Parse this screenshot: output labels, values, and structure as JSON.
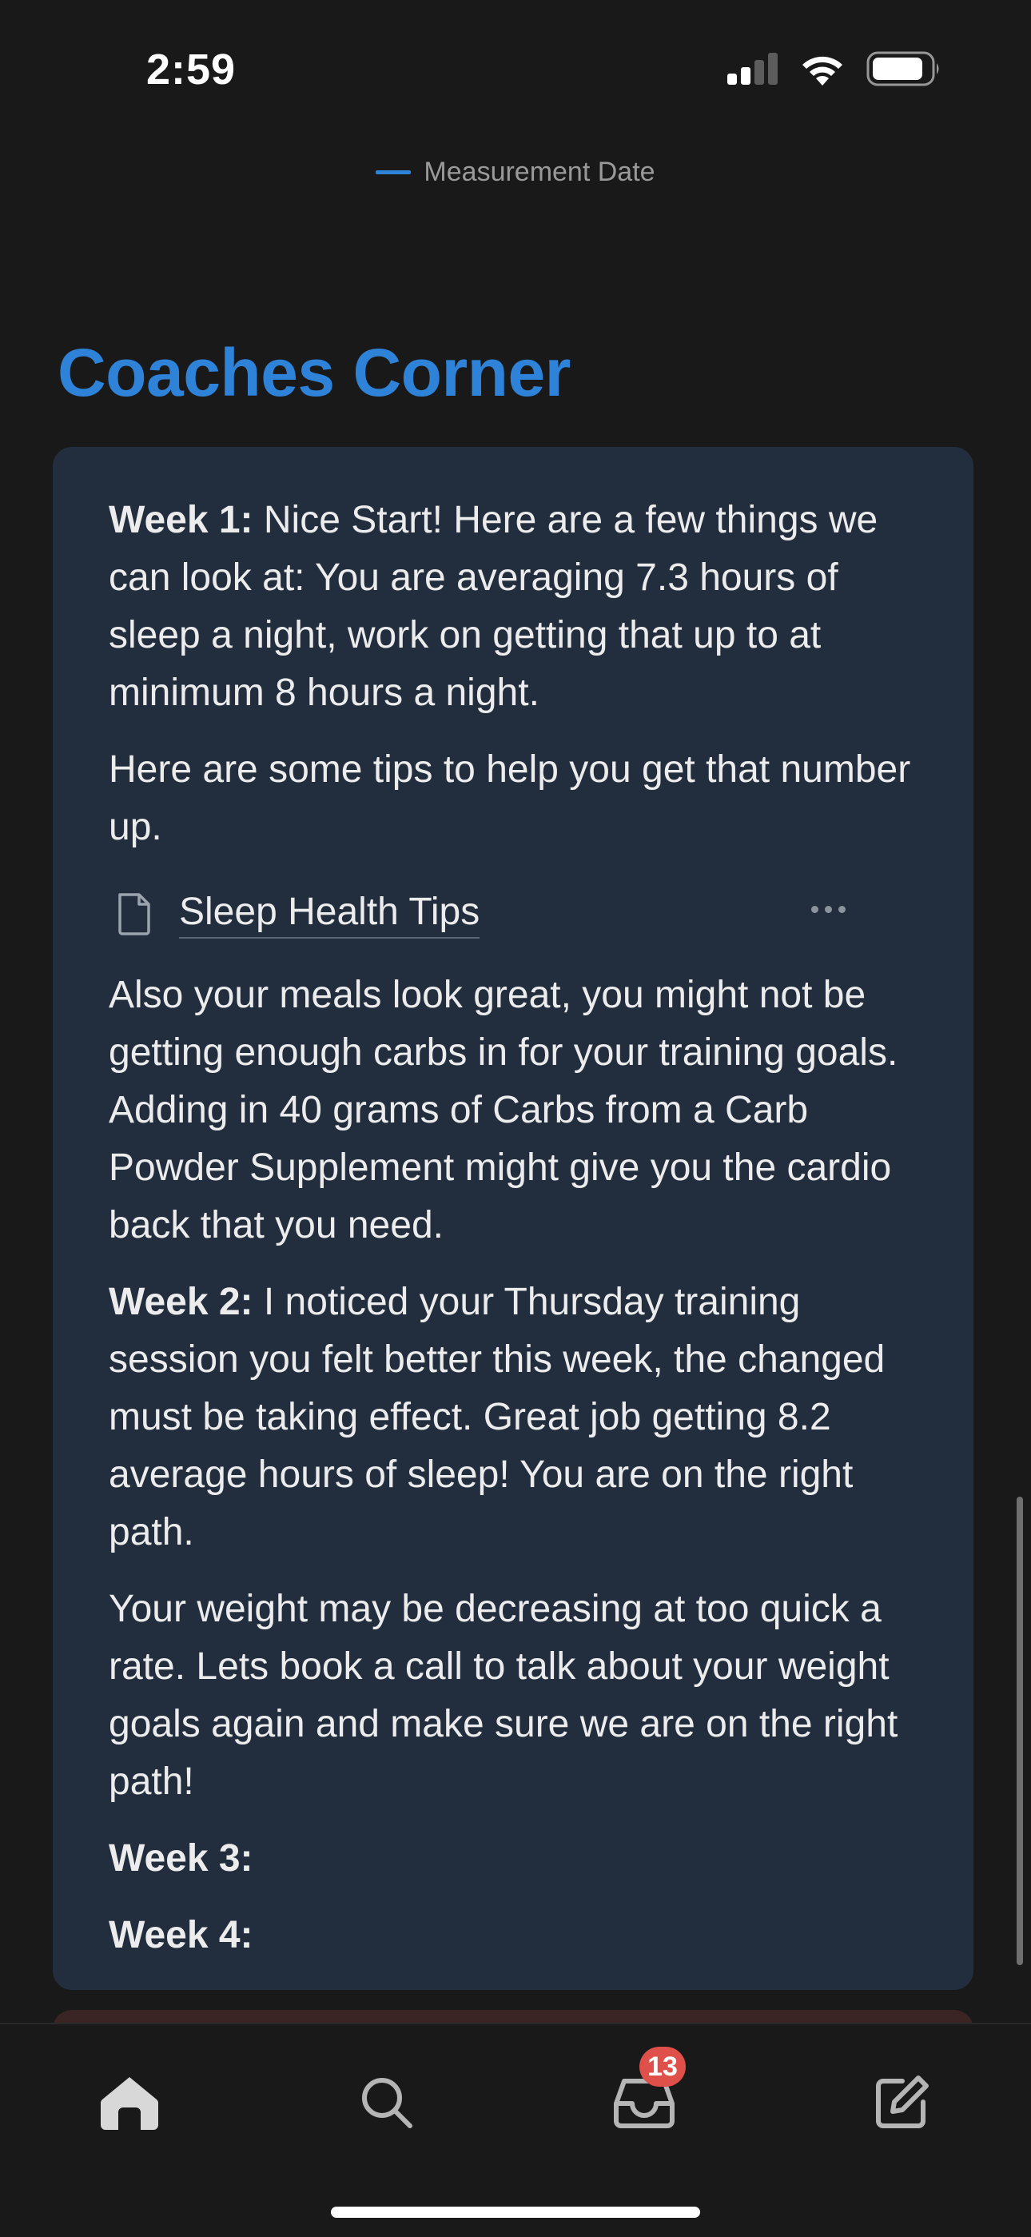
{
  "status_bar": {
    "time": "2:59"
  },
  "legend": {
    "label": "Measurement Date",
    "color": "#2e82d8"
  },
  "heading": "Coaches Corner",
  "callout": {
    "week1": {
      "label": "Week 1:",
      "text": " Nice Start! Here are a few things we can look at: You are averaging 7.3 hours of sleep a night, work on getting that up to at minimum 8 hours a night."
    },
    "tips_intro": "Here are some tips to help you get that number up.",
    "page_link": {
      "title": "Sleep Health Tips",
      "icon": "page-icon"
    },
    "meals_text": "Also your meals look great, you might not be getting enough carbs in for your training goals. Adding in 40 grams of Carbs from a Carb Powder Supplement might give you the cardio back that you need.",
    "week2": {
      "label": "Week 2:",
      "text": " I noticed your Thursday training session you felt better this week, the changed must be taking effect. Great job getting 8.2 average hours of sleep! You are on the right path."
    },
    "weight_text": "Your weight may be decreasing at too quick a rate. Lets book a call to talk about your weight goals again and make sure we are on the right path!",
    "week3": "Week 3:",
    "week4": "Week 4:"
  },
  "bottom_nav": {
    "items": [
      "home-icon",
      "search-icon",
      "inbox-icon",
      "compose-icon"
    ],
    "inbox_badge": "13"
  },
  "colors": {
    "background": "#191919",
    "callout_bg": "#222e3e",
    "accent": "#2e82d8",
    "badge": "#e0504a"
  }
}
